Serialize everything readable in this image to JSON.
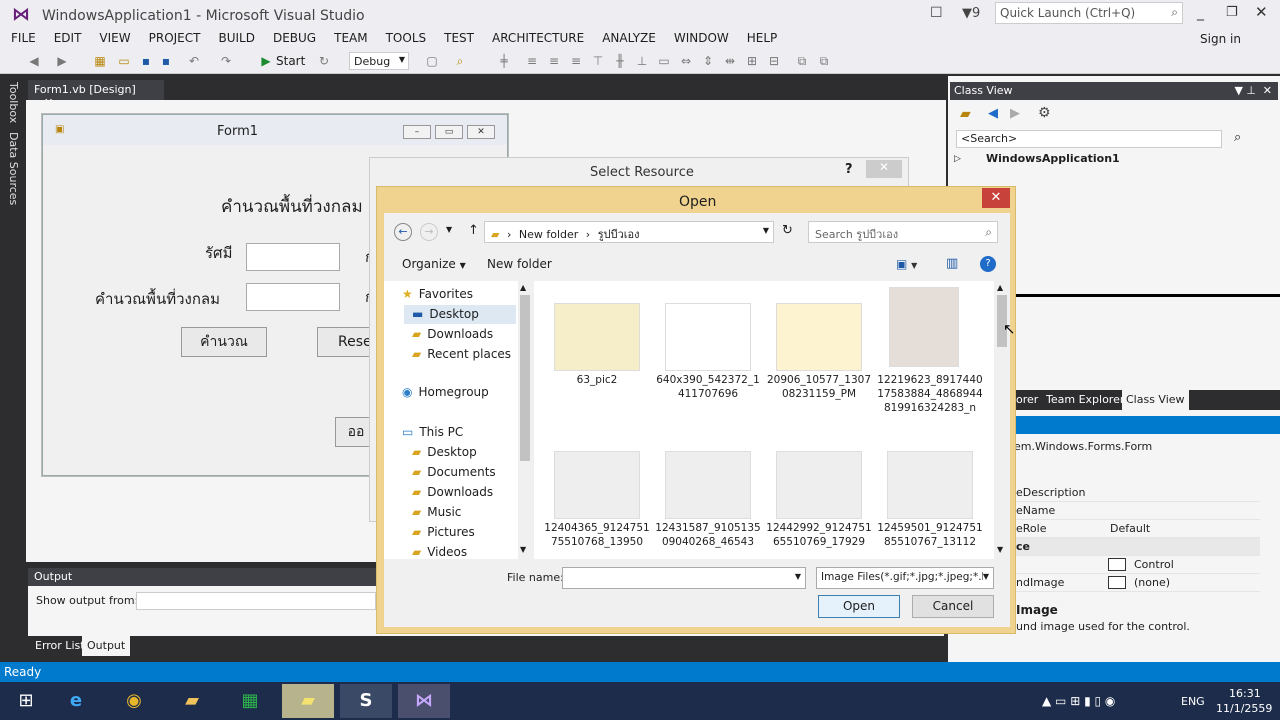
{
  "window": {
    "title": "WindowsApplication1 - Microsoft Visual Studio",
    "filter_count": "9",
    "quick_launch": "Quick Launch (Ctrl+Q)",
    "sign_in": "Sign in"
  },
  "menu": [
    "FILE",
    "EDIT",
    "VIEW",
    "PROJECT",
    "BUILD",
    "DEBUG",
    "TEAM",
    "TOOLS",
    "TEST",
    "ARCHITECTURE",
    "ANALYZE",
    "WINDOW",
    "HELP"
  ],
  "toolbar": {
    "start": "Start",
    "config": "Debug"
  },
  "side_tabs": [
    "Toolbox",
    "Data Sources"
  ],
  "doc_tab": "Form1.vb [Design]",
  "form1": {
    "title": "Form1",
    "heading": "คำนวณพื้นที่วงกลม",
    "label_radius": "รัศมี",
    "label_area": "คำนวณพื้นที่วงกลม",
    "btn_calc": "คำนวณ",
    "btn_reset": "Rese",
    "btn_exit": "ออ",
    "suffix1": "ก",
    "suffix2": "ก"
  },
  "output": {
    "header": "Output",
    "show_from": "Show output from:",
    "tabs": [
      "Error List",
      "Output"
    ]
  },
  "classview": {
    "header": "Class View",
    "search": "<Search>",
    "root": "WindowsApplication1",
    "tabs": [
      "orer",
      "Team Explorer",
      "Class View"
    ],
    "props_type": "em.Windows.Forms.Form",
    "props": [
      {
        "n": "eDescription",
        "v": ""
      },
      {
        "n": "eName",
        "v": ""
      },
      {
        "n": "eRole",
        "v": "Default"
      },
      {
        "n": "ce",
        "v": ""
      },
      {
        "n": "",
        "v": "Control"
      },
      {
        "n": "ndImage",
        "v": "(none)"
      }
    ],
    "desc_title": "Image",
    "desc_text": "und image used for the control."
  },
  "select_resource": {
    "title": "Select Resource",
    "help": "?"
  },
  "open_dialog": {
    "title": "Open",
    "path": [
      "New folder",
      "รูปบีวเอง"
    ],
    "search": "Search รูปบีวเอง",
    "organize": "Organize",
    "new_folder": "New folder",
    "nav": [
      {
        "label": "Favorites",
        "indent": 0,
        "icon": "star"
      },
      {
        "label": "Desktop",
        "indent": 1,
        "icon": "desktop"
      },
      {
        "label": "Downloads",
        "indent": 1,
        "icon": "folder"
      },
      {
        "label": "Recent places",
        "indent": 1,
        "icon": "folder"
      },
      {
        "label": "Homegroup",
        "indent": 0,
        "icon": "home"
      },
      {
        "label": "This PC",
        "indent": 0,
        "icon": "pc"
      },
      {
        "label": "Desktop",
        "indent": 1,
        "icon": "folder"
      },
      {
        "label": "Documents",
        "indent": 1,
        "icon": "folder"
      },
      {
        "label": "Downloads",
        "indent": 1,
        "icon": "folder"
      },
      {
        "label": "Music",
        "indent": 1,
        "icon": "folder"
      },
      {
        "label": "Pictures",
        "indent": 1,
        "icon": "folder"
      },
      {
        "label": "Videos",
        "indent": 1,
        "icon": "folder"
      }
    ],
    "files": [
      {
        "name": "63_pic2",
        "color": "#f5eec8"
      },
      {
        "name": "640x390_542372_1411707696",
        "color": "#ffffff"
      },
      {
        "name": "20906_10577_130708231159_PM",
        "color": "#fdf3d0"
      },
      {
        "name": "12219623_891744017583884_4868944819916324283_n",
        "color": "#e5ddd8"
      },
      {
        "name": "12404365_912475175510768_13950",
        "color": "#eeeeee"
      },
      {
        "name": "12431587_910513509040268_46543",
        "color": "#eeeeee"
      },
      {
        "name": "12442992_912475165510769_17929",
        "color": "#eeeeee"
      },
      {
        "name": "12459501_912475185510767_13112",
        "color": "#eeeeee"
      }
    ],
    "file_name_label": "File name:",
    "file_name": "",
    "file_type": "Image Files(*.gif;*.jpg;*.jpeg;*.b",
    "open": "Open",
    "cancel": "Cancel"
  },
  "status": "Ready",
  "clock": {
    "time": "16:31",
    "date": "11/1/2559",
    "lang": "ENG"
  }
}
